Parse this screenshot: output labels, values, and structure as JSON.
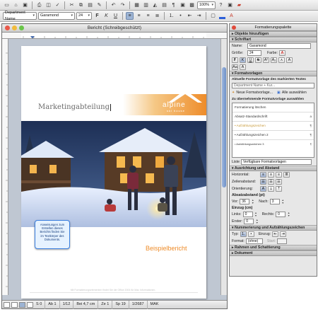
{
  "toolbar": {
    "style_select": "Department Name",
    "font_select": "Garamond",
    "size_select": "24",
    "zoom": "100%",
    "bold_label": "F",
    "italic_label": "K",
    "underline_label": "U"
  },
  "window": {
    "title": "Bericht (Schreibgeschützt)"
  },
  "document": {
    "logo_text": "alpine",
    "logo_sub": "ski house",
    "department_text": "Marketingabteilung",
    "note_text": "Anweisungen zum Erstellen dieses Berichts finden Sie im Textkörper des Dokuments.",
    "report_title": "Beispielbericht",
    "footer_text": "Mit Formatierungselementen findet Sie die Office 2004 für Mac Informationen."
  },
  "status": {
    "section": "S 0",
    "page_section": "Ab 1",
    "pages": "1/12",
    "position": "Bei 4,7 cm",
    "line": "Ze 1",
    "column": "Sp 19",
    "words": "1/2687",
    "mode": "MAK"
  },
  "palette": {
    "title": "Formatierungspalette",
    "sections": {
      "objects": "Objekte hinzufügen",
      "font": "Schriftart",
      "styles": "Formatvorlagen",
      "alignment": "Ausrichtung und Abstand",
      "numbering": "Nummerierung und Aufzählungszeichen",
      "borders": "Rahmen und Schattierung",
      "document": "Dokument"
    },
    "font": {
      "name_label": "Name:",
      "name_value": "Garamond",
      "size_label": "Größe:",
      "size_value": "24",
      "color_label": "Farbe:"
    },
    "styles": {
      "current_label": "Aktuelle Formatvorlage des markierten Textes",
      "current_value": "Department Name + Kur...",
      "new_label": "Neue Formatvorlage...",
      "select_all_label": "Alle auswählen",
      "apply_label": "Zu übernehmende Formatvorlage auswählen",
      "items": [
        "Formatierung löschen",
        "Absatz-Standardschrift",
        "Aufzählungszeichen",
        "Aufzählungszeichen 2",
        "Aufzählungszeichen 3"
      ],
      "list_label": "Liste",
      "list_value": "Verfügbare Formatvorlagen"
    },
    "alignment": {
      "horizontal_label": "Horizontal:",
      "linespacing_label": "Zeilenabstand:",
      "orientation_label": "Orientierung:",
      "paragraph_label": "Absatzabstand (pt)",
      "before_label": "Vor:",
      "before_value": "36",
      "after_label": "Nach:",
      "after_value": "3",
      "indent_label": "Einzug (cm)",
      "left_label": "Links:",
      "left_value": "0",
      "right_label": "Rechts:",
      "right_value": "0",
      "first_label": "Erster:",
      "first_value": "0"
    },
    "numbering": {
      "type_label": "Typ:",
      "indent_label": "Einzug:",
      "format_label": "Format:",
      "format_value": "(ohne)",
      "start_label": "Start:"
    }
  },
  "colors": {
    "accent_orange": "#ee8c2a",
    "selection_blue": "#9db4d4"
  }
}
